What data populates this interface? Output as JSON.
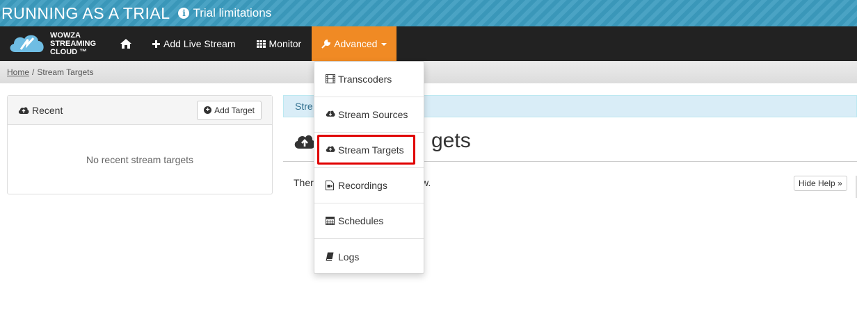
{
  "trial": {
    "title": "RUNNING AS A TRIAL",
    "link_label": "Trial limitations",
    "info_glyph": "i"
  },
  "brand": {
    "line1": "WOWZA",
    "line2": "STREAMING",
    "line3": "CLOUD ™"
  },
  "nav": {
    "home_icon": "home-icon",
    "add_live_stream": "Add Live Stream",
    "monitor": "Monitor",
    "advanced": "Advanced"
  },
  "breadcrumb": {
    "home": "Home",
    "separator": "/",
    "current": "Stream Targets"
  },
  "recent_panel": {
    "title": "Recent",
    "add_button": "Add Target",
    "empty_text": "No recent stream targets"
  },
  "main": {
    "alert_text": "Stre",
    "heading": "gets",
    "empty_prefix": "Ther",
    "empty_suffix": "o show.",
    "hide_help": "Hide Help »"
  },
  "dropdown": {
    "items": [
      {
        "label": "Transcoders",
        "icon": "film-icon"
      },
      {
        "label": "Stream Sources",
        "icon": "cloud-download-icon"
      },
      {
        "label": "Stream Targets",
        "icon": "cloud-upload-icon",
        "highlighted": true
      },
      {
        "label": "Recordings",
        "icon": "video-file-icon"
      },
      {
        "label": "Schedules",
        "icon": "calendar-icon"
      },
      {
        "label": "Logs",
        "icon": "book-icon"
      }
    ]
  },
  "colors": {
    "banner": "#3a97b9",
    "navbar": "#222222",
    "advanced_active": "#f08a24",
    "highlight": "#e00000",
    "alert_bg": "#d9edf7"
  }
}
